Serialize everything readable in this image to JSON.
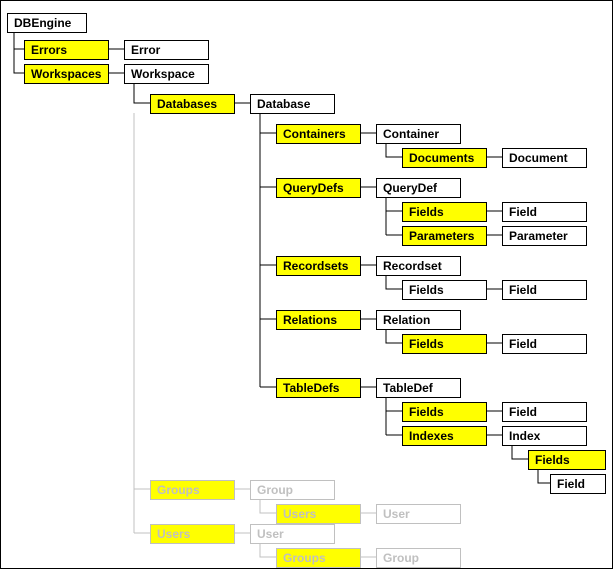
{
  "nodes": {
    "dbengine": "DBEngine",
    "errors": "Errors",
    "error": "Error",
    "workspaces": "Workspaces",
    "workspace": "Workspace",
    "databases": "Databases",
    "database": "Database",
    "containers": "Containers",
    "container": "Container",
    "documents": "Documents",
    "document": "Document",
    "querydefs": "QueryDefs",
    "querydef": "QueryDef",
    "fields_qd": "Fields",
    "field_qd": "Field",
    "parameters": "Parameters",
    "parameter": "Parameter",
    "recordsets": "Recordsets",
    "recordset": "Recordset",
    "fields_rs": "Fields",
    "field_rs": "Field",
    "relations": "Relations",
    "relation": "Relation",
    "fields_rel": "Fields",
    "field_rel": "Field",
    "tabledefs": "TableDefs",
    "tabledef": "TableDef",
    "fields_td": "Fields",
    "field_td": "Field",
    "indexes": "Indexes",
    "index": "Index",
    "fields_idx": "Fields",
    "field_idx": "Field",
    "groups": "Groups",
    "group": "Group",
    "users_in_group": "Users",
    "user_in_group": "User",
    "users": "Users",
    "user": "User",
    "groups_in_user": "Groups",
    "group_in_user": "Group"
  }
}
